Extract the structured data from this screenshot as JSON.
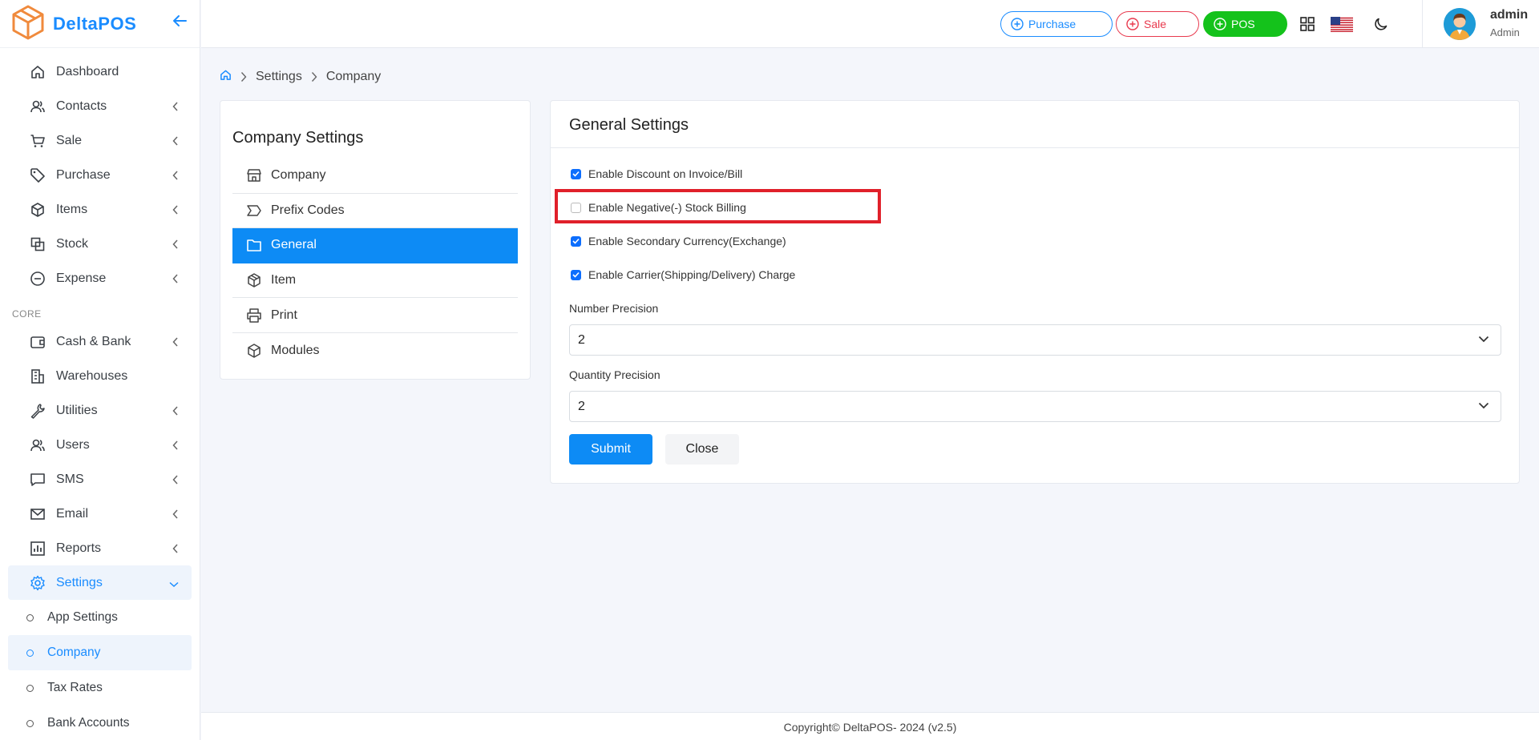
{
  "brand": {
    "name": "DeltaPOS"
  },
  "sidebar": {
    "items": [
      {
        "label": "Dashboard",
        "icon": "home-icon",
        "has_children": false
      },
      {
        "label": "Contacts",
        "icon": "users-icon",
        "has_children": true
      },
      {
        "label": "Sale",
        "icon": "cart-icon",
        "has_children": true
      },
      {
        "label": "Purchase",
        "icon": "tag-icon",
        "has_children": true
      },
      {
        "label": "Items",
        "icon": "box-icon",
        "has_children": true
      },
      {
        "label": "Stock",
        "icon": "stock-icon",
        "has_children": true
      },
      {
        "label": "Expense",
        "icon": "minus-circle-icon",
        "has_children": true
      }
    ],
    "section_core": "CORE",
    "core_items": [
      {
        "label": "Cash & Bank",
        "icon": "wallet-icon",
        "has_children": true
      },
      {
        "label": "Warehouses",
        "icon": "building-icon",
        "has_children": false
      },
      {
        "label": "Utilities",
        "icon": "wrench-icon",
        "has_children": true
      },
      {
        "label": "Users",
        "icon": "users-icon",
        "has_children": true
      },
      {
        "label": "SMS",
        "icon": "message-icon",
        "has_children": true
      },
      {
        "label": "Email",
        "icon": "mail-icon",
        "has_children": true
      },
      {
        "label": "Reports",
        "icon": "chart-icon",
        "has_children": true
      },
      {
        "label": "Settings",
        "icon": "gear-icon",
        "has_children": true,
        "active": true
      }
    ],
    "settings_sub": [
      {
        "label": "App Settings",
        "active": false
      },
      {
        "label": "Company",
        "active": true
      },
      {
        "label": "Tax Rates",
        "active": false
      },
      {
        "label": "Bank Accounts",
        "active": false
      }
    ]
  },
  "topbar": {
    "purchase_label": "Purchase",
    "sale_label": "Sale",
    "pos_label": "POS",
    "user_name": "admin",
    "user_role": "Admin"
  },
  "breadcrumb": {
    "items": [
      "Settings",
      "Company"
    ]
  },
  "company_settings": {
    "title": "Company Settings",
    "menu": [
      {
        "label": "Company",
        "icon": "store-icon",
        "active": false
      },
      {
        "label": "Prefix Codes",
        "icon": "prefix-icon",
        "active": false
      },
      {
        "label": "General",
        "icon": "folder-icon",
        "active": true
      },
      {
        "label": "Item",
        "icon": "item-box-icon",
        "active": false
      },
      {
        "label": "Print",
        "icon": "printer-icon",
        "active": false
      },
      {
        "label": "Modules",
        "icon": "cube-icon",
        "active": false
      }
    ]
  },
  "general_settings": {
    "title": "General Settings",
    "options": [
      {
        "label": "Enable Discount on Invoice/Bill",
        "checked": true
      },
      {
        "label": "Enable Negative(-) Stock Billing",
        "checked": false
      },
      {
        "label": "Enable Secondary Currency(Exchange)",
        "checked": true
      },
      {
        "label": "Enable Carrier(Shipping/Delivery) Charge",
        "checked": true
      }
    ],
    "number_precision_label": "Number Precision",
    "number_precision_value": "2",
    "quantity_precision_label": "Quantity Precision",
    "quantity_precision_value": "2",
    "submit_label": "Submit",
    "close_label": "Close"
  },
  "footer": {
    "text": "Copyright© DeltaPOS- 2024 (v2.5)"
  },
  "colors": {
    "accent": "#0d8bf5",
    "sale": "#e8394d",
    "pos": "#14c21b",
    "highlight": "#e0202a"
  }
}
